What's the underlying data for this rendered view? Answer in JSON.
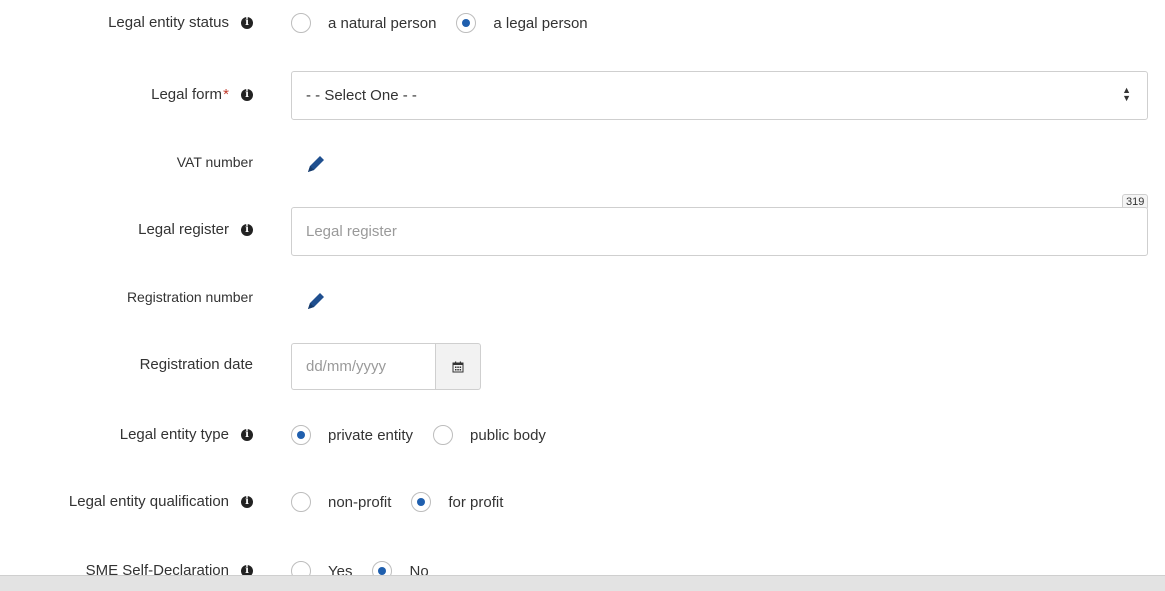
{
  "form": {
    "legal_entity_status": {
      "label": "Legal entity status",
      "options": [
        "a natural person",
        "a legal person"
      ],
      "selected": "a legal person"
    },
    "legal_form": {
      "label": "Legal form",
      "required_mark": "*",
      "value": "- - Select One - -"
    },
    "vat_number": {
      "label": "VAT number"
    },
    "legal_register": {
      "label": "Legal register",
      "placeholder": "Legal register",
      "counter": "319"
    },
    "registration_number": {
      "label": "Registration number"
    },
    "registration_date": {
      "label": "Registration date",
      "placeholder": "dd/mm/yyyy"
    },
    "legal_entity_type": {
      "label": "Legal entity type",
      "options": [
        "private entity",
        "public body"
      ],
      "selected": "private entity"
    },
    "legal_entity_qualification": {
      "label": "Legal entity qualification",
      "options": [
        "non-profit",
        "for profit"
      ],
      "selected": "for profit"
    },
    "sme_self_declaration": {
      "label": "SME Self-Declaration",
      "options": [
        "Yes",
        "No"
      ],
      "selected": "No"
    }
  },
  "icons": {
    "info": "info-icon",
    "edit": "pencil-icon",
    "calendar": "calendar-icon"
  },
  "colors": {
    "accent": "#1f5fae",
    "required": "#c0392b"
  }
}
